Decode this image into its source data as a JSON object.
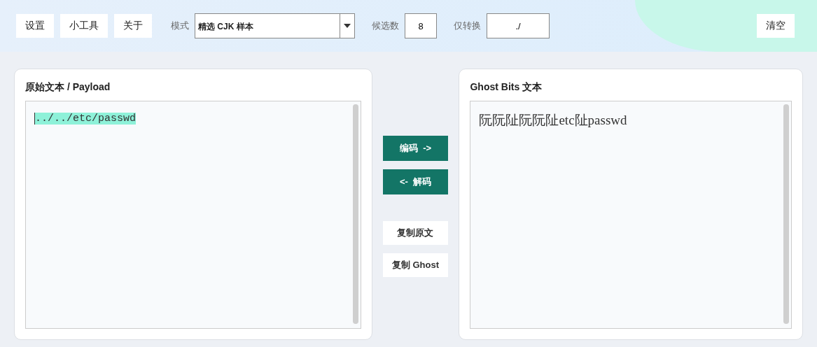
{
  "toolbar": {
    "menu_buttons": [
      "设置",
      "小工具",
      "关于"
    ],
    "mode": {
      "label": "模式",
      "value": "精选 CJK 样本"
    },
    "candidates": {
      "label": "候选数",
      "value": "8"
    },
    "convert_only": {
      "label": "仅转换",
      "value": "./"
    },
    "clear_button": "清空"
  },
  "source_panel": {
    "title": "原始文本 / Payload",
    "text": "../../etc/passwd",
    "selected": true
  },
  "actions": [
    {
      "label": "编码  ->",
      "kind": "primary"
    },
    {
      "label": "<-  解码",
      "kind": "primary"
    },
    {
      "label": "复制原文",
      "kind": "secondary"
    },
    {
      "label": "复制 Ghost",
      "kind": "secondary"
    }
  ],
  "output_panel": {
    "title": "Ghost Bits 文本",
    "text": "阮阮阯阮阮阯etc阯passwd"
  }
}
